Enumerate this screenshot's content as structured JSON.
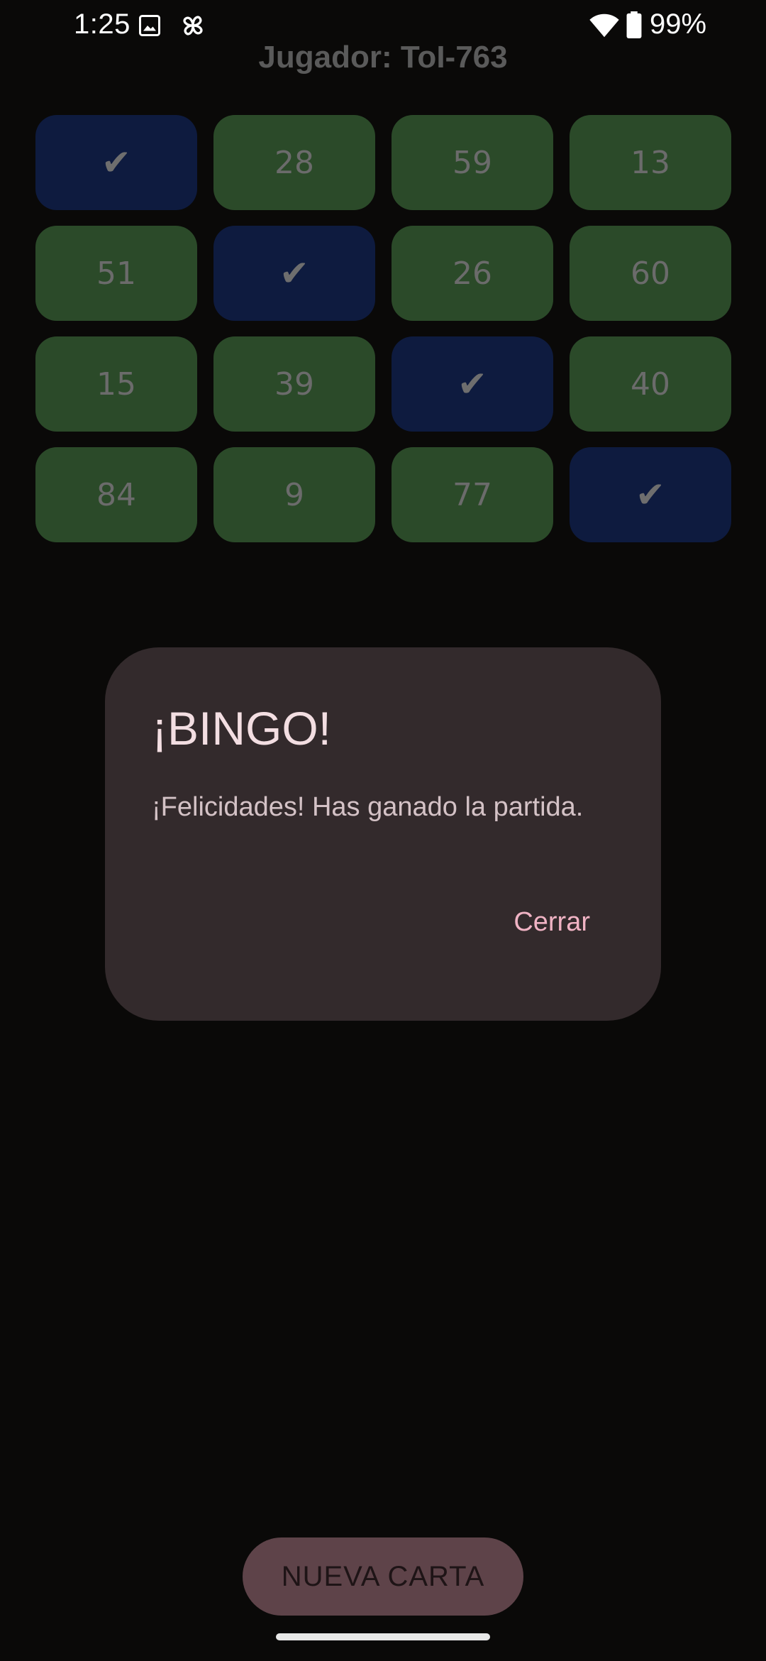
{
  "status_bar": {
    "time": "1:25",
    "battery_percent": "99%",
    "icons": [
      "image-icon",
      "pinwheel-icon",
      "wifi-icon",
      "battery-icon"
    ]
  },
  "header": {
    "player_label": "Jugador: ToI-763"
  },
  "card": {
    "cells": [
      {
        "value": "✔",
        "marked": true
      },
      {
        "value": "28",
        "marked": false
      },
      {
        "value": "59",
        "marked": false
      },
      {
        "value": "13",
        "marked": false
      },
      {
        "value": "51",
        "marked": false
      },
      {
        "value": "✔",
        "marked": true
      },
      {
        "value": "26",
        "marked": false
      },
      {
        "value": "60",
        "marked": false
      },
      {
        "value": "15",
        "marked": false
      },
      {
        "value": "39",
        "marked": false
      },
      {
        "value": "✔",
        "marked": true
      },
      {
        "value": "40",
        "marked": false
      },
      {
        "value": "84",
        "marked": false
      },
      {
        "value": "9",
        "marked": false
      },
      {
        "value": "77",
        "marked": false
      },
      {
        "value": "✔",
        "marked": true
      }
    ]
  },
  "dialog": {
    "title": "¡BINGO!",
    "message": "¡Felicidades! Has ganado la partida.",
    "close_label": "Cerrar"
  },
  "footer": {
    "new_card_label": "NUEVA CARTA"
  },
  "colors": {
    "cell_number_bg": "#2b4a29",
    "cell_marked_bg": "#0e1b3f",
    "dialog_bg": "#332a2c",
    "accent": "#f0b3c4"
  }
}
